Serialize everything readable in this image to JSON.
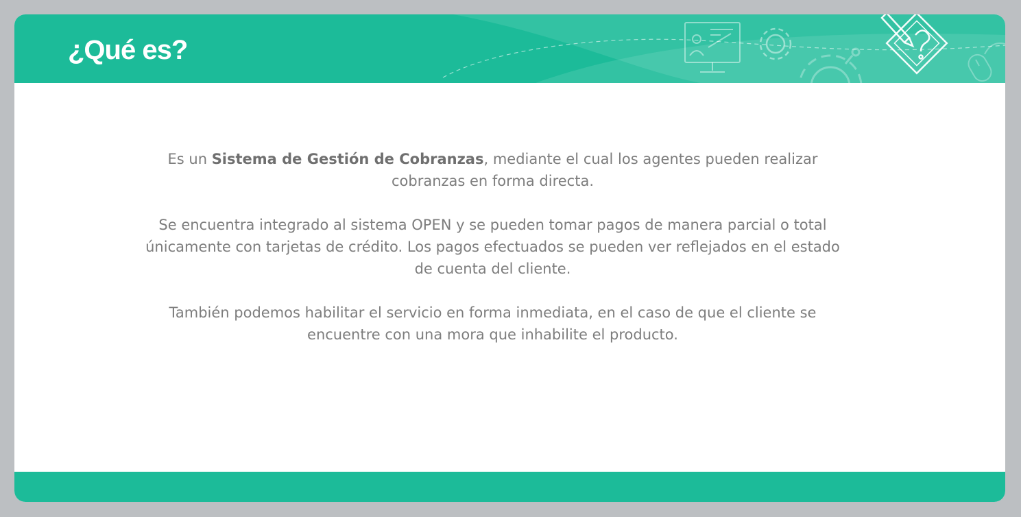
{
  "header": {
    "title": "¿Qué es?",
    "bg_color": "#1cbb99",
    "decor_icons": [
      "presentation-board-icon",
      "gear-icon",
      "large-gear-icon",
      "pencil-certificate-icon",
      "mouse-icon"
    ]
  },
  "content": {
    "p1": {
      "before": "Es un ",
      "bold": "Sistema de Gestión de Cobranzas",
      "after": ", mediante el cual los agentes pueden realizar cobranzas en forma directa."
    },
    "p2": "Se encuentra integrado al sistema OPEN y se pueden tomar pagos de manera parcial o total únicamente con tarjetas de crédito. Los pagos efectuados se pueden ver reflejados en el estado de cuenta del cliente.",
    "p3": "También podemos habilitar el servicio en forma inmediata, en el caso de que el cliente se encuentre con una mora que inhabilite el producto."
  },
  "footer": {
    "bg_color": "#1cbb99"
  },
  "colors": {
    "accent": "#1cbb99",
    "text": "#7d7d7d",
    "background": "#bcbfc2"
  }
}
